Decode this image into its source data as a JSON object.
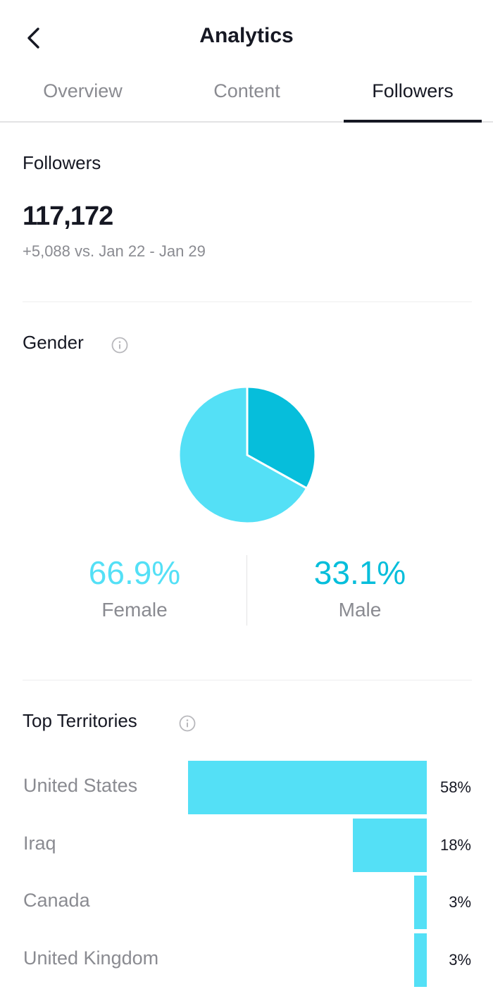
{
  "header": {
    "title": "Analytics",
    "back_icon": "chevron-left-icon"
  },
  "tabs": [
    {
      "label": "Overview",
      "active": false
    },
    {
      "label": "Content",
      "active": false
    },
    {
      "label": "Followers",
      "active": true
    }
  ],
  "followers": {
    "heading": "Followers",
    "count": "117,172",
    "change": "+5,088 vs. Jan 22 - Jan 29"
  },
  "gender": {
    "heading": "Gender",
    "info_icon": "info-icon",
    "female": {
      "label": "Female",
      "value_text": "66.9%",
      "color": "#54e0f6"
    },
    "male": {
      "label": "Male",
      "value_text": "33.1%",
      "color": "#06bedb"
    }
  },
  "territories": {
    "heading": "Top Territories",
    "info_icon": "info-icon",
    "bar_color": "#54e0f6"
  },
  "chart_data": [
    {
      "type": "pie",
      "title": "Gender",
      "categories": [
        "Female",
        "Male"
      ],
      "values": [
        66.9,
        33.1
      ],
      "colors": [
        "#54e0f6",
        "#06bedb"
      ]
    },
    {
      "type": "bar",
      "orientation": "horizontal",
      "title": "Top Territories",
      "categories": [
        "United States",
        "Iraq",
        "Canada",
        "United Kingdom"
      ],
      "values": [
        58,
        18,
        3,
        3
      ],
      "value_labels": [
        "58%",
        "18%",
        "3%",
        "3%"
      ],
      "unit": "%",
      "xlim": [
        0,
        58
      ]
    }
  ]
}
